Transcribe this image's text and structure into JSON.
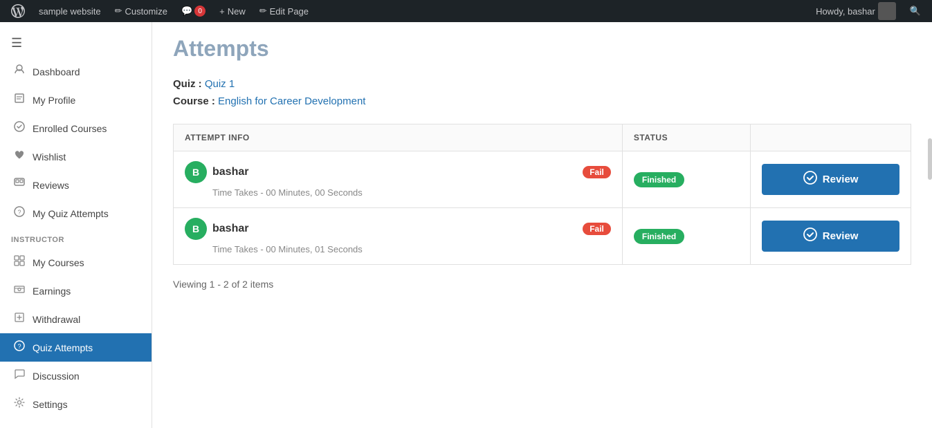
{
  "adminBar": {
    "wpIcon": "WordPress",
    "siteLabel": "sample website",
    "customizeLabel": "Customize",
    "commentsLabel": "0",
    "newLabel": "New",
    "editPageLabel": "Edit Page",
    "howdyLabel": "Howdy, bashar"
  },
  "sidebar": {
    "hamburgerIcon": "☰",
    "navItems": [
      {
        "id": "dashboard",
        "label": "Dashboard",
        "icon": "👤"
      },
      {
        "id": "my-profile",
        "label": "My Profile",
        "icon": "👤"
      },
      {
        "id": "enrolled-courses",
        "label": "Enrolled Courses",
        "icon": "🎓"
      },
      {
        "id": "wishlist",
        "label": "Wishlist",
        "icon": "♥"
      },
      {
        "id": "reviews",
        "label": "Reviews",
        "icon": "⧉"
      },
      {
        "id": "my-quiz-attempts",
        "label": "My Quiz Attempts",
        "icon": "?"
      }
    ],
    "instructorTitle": "INSTRUCTOR",
    "instructorItems": [
      {
        "id": "my-courses",
        "label": "My Courses",
        "icon": "⊞"
      },
      {
        "id": "earnings",
        "label": "Earnings",
        "icon": "💰"
      },
      {
        "id": "withdrawal",
        "label": "Withdrawal",
        "icon": "↑"
      },
      {
        "id": "quiz-attempts",
        "label": "Quiz Attempts",
        "icon": "?",
        "active": true
      },
      {
        "id": "discussion",
        "label": "Discussion",
        "icon": "💬"
      },
      {
        "id": "settings",
        "label": "Settings",
        "icon": "⚙"
      }
    ]
  },
  "main": {
    "pageTitle": "Attempts",
    "quizLabel": "Quiz :",
    "quizLink": "Quiz 1",
    "courseLabel": "Course :",
    "courseLink": "English for Career Development",
    "table": {
      "headers": {
        "attemptInfo": "ATTEMPT INFO",
        "status": "STATUS",
        "action": ""
      },
      "rows": [
        {
          "avatarLetter": "B",
          "username": "bashar",
          "failLabel": "Fail",
          "timeLabel": "Time Takes - 00 Minutes, 00 Seconds",
          "statusLabel": "Finished",
          "actionLabel": "Review"
        },
        {
          "avatarLetter": "B",
          "username": "bashar",
          "failLabel": "Fail",
          "timeLabel": "Time Takes - 00 Minutes, 01 Seconds",
          "statusLabel": "Finished",
          "actionLabel": "Review"
        }
      ]
    },
    "viewingText": "Viewing 1 - 2 of 2 items"
  }
}
